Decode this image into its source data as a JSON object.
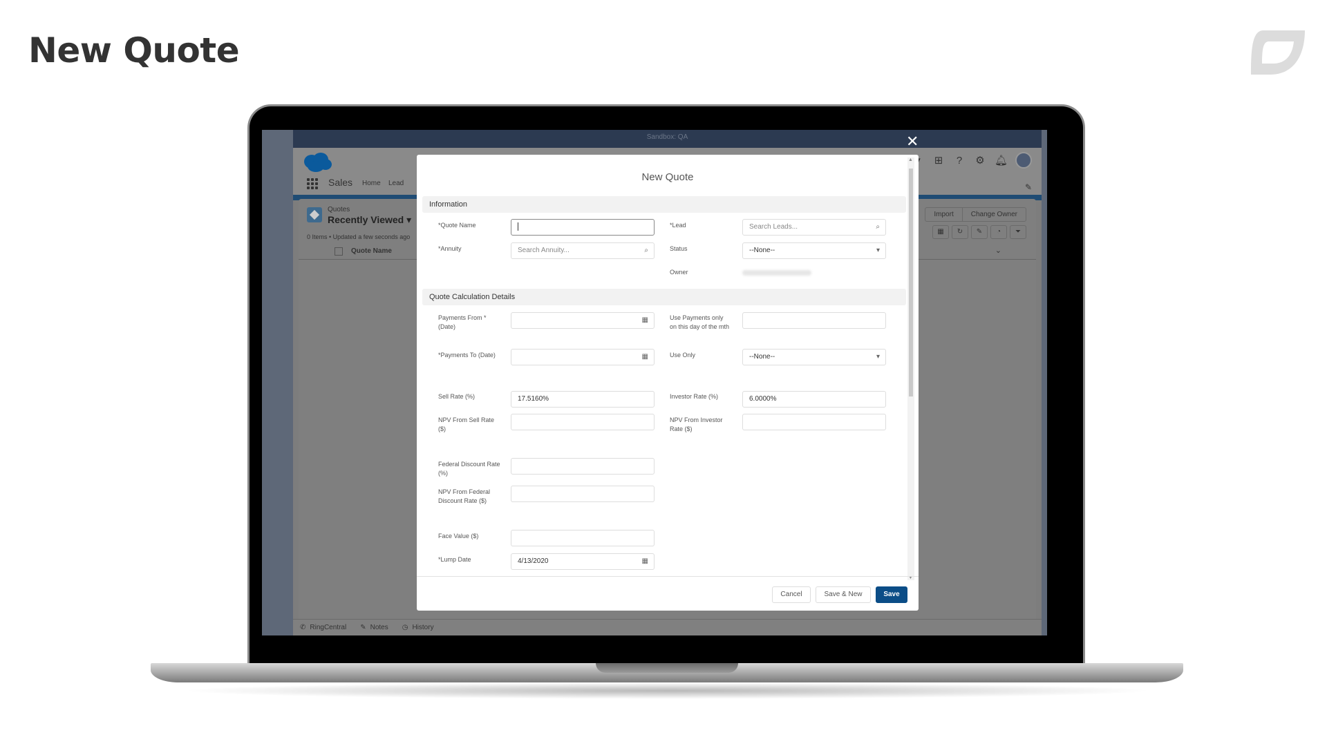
{
  "slide": {
    "title": "New Quote",
    "logo_icon": "leaf-brand-icon"
  },
  "app": {
    "topbar_label": "Sandbox: QA",
    "app_name": "Sales",
    "nav": [
      "Home",
      "Lead"
    ],
    "header_icons": [
      "dropdown-icon",
      "add-icon",
      "help-icon",
      "gear-icon",
      "bell-icon",
      "avatar"
    ],
    "list": {
      "object_label": "Quotes",
      "title": "Recently Viewed",
      "meta": "0 Items • Updated a few seconds ago",
      "column": "Quote Name",
      "actions": [
        "Import",
        "Change Owner"
      ]
    },
    "utility_bar": [
      {
        "icon": "phone-icon",
        "label": "RingCentral"
      },
      {
        "icon": "notes-icon",
        "label": "Notes"
      },
      {
        "icon": "clock-icon",
        "label": "History"
      }
    ]
  },
  "modal": {
    "title": "New Quote",
    "sections": {
      "info": "Information",
      "calc": "Quote Calculation Details"
    },
    "fields": {
      "quote_name": {
        "label": "*Quote Name",
        "value": ""
      },
      "lead": {
        "label": "*Lead",
        "placeholder": "Search Leads..."
      },
      "annuity": {
        "label": "*Annuity",
        "placeholder": "Search Annuity..."
      },
      "status": {
        "label": "Status",
        "value": "--None--"
      },
      "owner": {
        "label": "Owner"
      },
      "payments_from": {
        "label": "Payments From *(Date)",
        "value": ""
      },
      "use_payments_only": {
        "label": "Use Payments only on this day of the mth",
        "value": ""
      },
      "payments_to": {
        "label": "*Payments To (Date)",
        "value": ""
      },
      "use_only": {
        "label": "Use Only",
        "value": "--None--"
      },
      "sell_rate": {
        "label": "Sell Rate (%)",
        "value": "17.5160%"
      },
      "investor_rate": {
        "label": "Investor Rate (%)",
        "value": "6.0000%"
      },
      "npv_sell": {
        "label": "NPV From Sell Rate ($)",
        "value": ""
      },
      "npv_investor": {
        "label": "NPV From Investor Rate ($)",
        "value": ""
      },
      "federal_discount": {
        "label": "Federal Discount Rate (%)",
        "value": ""
      },
      "npv_federal": {
        "label": "NPV From Federal Discount Rate ($)",
        "value": ""
      },
      "face_value": {
        "label": "Face Value ($)",
        "value": ""
      },
      "lump_date": {
        "label": "*Lump Date",
        "value": "4/13/2020"
      }
    },
    "buttons": {
      "cancel": "Cancel",
      "save_new": "Save & New",
      "save": "Save"
    }
  },
  "colors": {
    "primary": "#0b4d87",
    "topbar": "#2c3a51",
    "title_text": "#333333"
  }
}
